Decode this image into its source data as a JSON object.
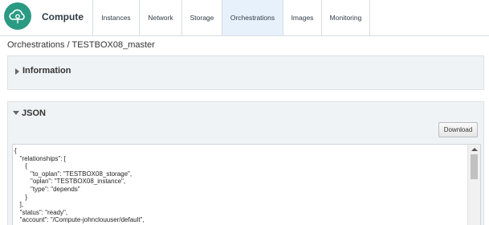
{
  "header": {
    "logo_icon": "cloud-gear-icon",
    "brand": "Compute",
    "accent_color": "#2a9a83",
    "tabs": [
      {
        "label": "Instances",
        "active": false
      },
      {
        "label": "Network",
        "active": false
      },
      {
        "label": "Storage",
        "active": false
      },
      {
        "label": "Orchestrations",
        "active": true
      },
      {
        "label": "Images",
        "active": false
      },
      {
        "label": "Monitoring",
        "active": false
      }
    ]
  },
  "breadcrumb": {
    "text": "Orchestrations / TESTBOX08_master"
  },
  "info_panel": {
    "title": "Information",
    "expanded": false,
    "icon": "triangle-right-icon"
  },
  "json_panel": {
    "title": "JSON",
    "expanded": true,
    "icon": "triangle-down-icon",
    "download_label": "Download",
    "code_lines": [
      "{",
      "   \"relationships\": [",
      "      {",
      "         \"to_oplan\": \"TESTBOX08_storage\",",
      "         \"oplan\": \"TESTBOX08_instance\",",
      "         \"type\": \"depends\"",
      "      }",
      "   ],",
      "   \"status\": \"ready\",",
      "   \"account\": \"/Compute-johnclouuser/default\","
    ]
  }
}
